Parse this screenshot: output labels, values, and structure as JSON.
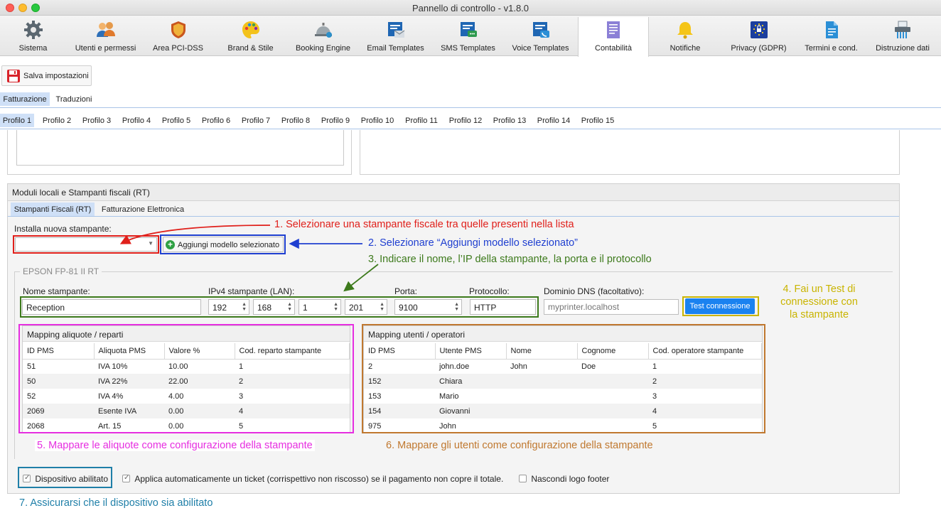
{
  "window": {
    "title": "Pannello di controllo - v1.8.0"
  },
  "toolbar": {
    "items": [
      {
        "label": "Sistema",
        "icon": "gear-icon"
      },
      {
        "label": "Utenti e permessi",
        "icon": "users-icon"
      },
      {
        "label": "Area PCI-DSS",
        "icon": "shield-icon"
      },
      {
        "label": "Brand & Stile",
        "icon": "palette-icon"
      },
      {
        "label": "Booking Engine",
        "icon": "service-bell-icon"
      },
      {
        "label": "Email Templates",
        "icon": "email-template-icon"
      },
      {
        "label": "SMS Templates",
        "icon": "sms-template-icon"
      },
      {
        "label": "Voice Templates",
        "icon": "voice-template-icon"
      },
      {
        "label": "Contabilità",
        "icon": "ledger-icon"
      },
      {
        "label": "Notifiche",
        "icon": "bell-icon"
      },
      {
        "label": "Privacy (GDPR)",
        "icon": "gdpr-lock-icon"
      },
      {
        "label": "Termini e cond.",
        "icon": "document-icon"
      },
      {
        "label": "Distruzione dati",
        "icon": "shredder-icon"
      }
    ],
    "active_item": "Contabilità"
  },
  "actions": {
    "save_label": "Salva impostazioni"
  },
  "main_tabs": [
    "Fatturazione",
    "Traduzioni"
  ],
  "profile_tabs": [
    "Profilo 1",
    "Profilo 2",
    "Profilo 3",
    "Profilo 4",
    "Profilo 5",
    "Profilo 6",
    "Profilo 7",
    "Profilo 8",
    "Profilo 9",
    "Profilo 10",
    "Profilo 11",
    "Profilo 12",
    "Profilo 13",
    "Profilo 14",
    "Profilo 15"
  ],
  "rt_section": {
    "title": "Moduli locali e Stampanti fiscali (RT)",
    "tabs": [
      "Stampanti Fiscali (RT)",
      "Fatturazione Elettronica"
    ],
    "install_label": "Installa nuova stampante:",
    "install_select_value": "",
    "add_model_label": "Aggiungi modello selezionato",
    "printer_group_title": "EPSON FP-81 II RT",
    "fields": {
      "name_label": "Nome stampante:",
      "name_value": "Reception",
      "ip_label": "IPv4 stampante (LAN):",
      "ip_octets": [
        "192",
        "168",
        "1",
        "201"
      ],
      "port_label": "Porta:",
      "port_value": "9100",
      "protocol_label": "Protocollo:",
      "protocol_value": "HTTP",
      "dns_label": "Dominio DNS (facoltativo):",
      "dns_placeholder": "myprinter.localhost",
      "test_button_label": "Test connessione"
    },
    "vat_mapping": {
      "title": "Mapping aliquote / reparti",
      "columns": [
        "ID PMS",
        "Aliquota PMS",
        "Valore %",
        "Cod. reparto stampante"
      ],
      "rows": [
        [
          "51",
          "IVA 10%",
          "10.00",
          "1"
        ],
        [
          "50",
          "IVA 22%",
          "22.00",
          "2"
        ],
        [
          "52",
          "IVA 4%",
          "4.00",
          "3"
        ],
        [
          "2069",
          "Esente IVA",
          "0.00",
          "4"
        ],
        [
          "2068",
          "Art. 15",
          "0.00",
          "5"
        ]
      ]
    },
    "user_mapping": {
      "title": "Mapping utenti / operatori",
      "columns": [
        "ID PMS",
        "Utente PMS",
        "Nome",
        "Cognome",
        "Cod. operatore stampante"
      ],
      "rows": [
        [
          "2",
          "john.doe",
          "John",
          "Doe",
          "1"
        ],
        [
          "152",
          "Chiara",
          "",
          "",
          "2"
        ],
        [
          "153",
          "Mario",
          "",
          "",
          "3"
        ],
        [
          "154",
          "Giovanni",
          "",
          "",
          "4"
        ],
        [
          "975",
          "John",
          "",
          "",
          "5"
        ]
      ]
    },
    "checkboxes": {
      "enabled_label": "Dispositivo abilitato",
      "enabled_checked": true,
      "auto_ticket_label": "Applica automaticamente un ticket (corrispettivo non riscosso) se il pagamento non copre il totale.",
      "auto_ticket_checked": true,
      "hide_logo_label": "Nascondi logo footer",
      "hide_logo_checked": false
    }
  },
  "annotations": {
    "step1": "1. Selezionare una stampante fiscale tra quelle presenti nella lista",
    "step2": "2. Selezionare “Aggiungi modello selezionato”",
    "step3": "3. Indicare il nome, l’IP della stampante, la porta e il protocollo",
    "step4_line1": "4. Fai un Test di",
    "step4_line2": "connessione con",
    "step4_line3": "la stampante",
    "step5": "5. Mappare le aliquote come configurazione della stampante",
    "step6": "6. Mappare gli utenti come configurazione della stampante",
    "step7": "7. Assicurarsi che il dispositivo sia abilitato"
  },
  "colors": {
    "step1": "#e0201b",
    "step2": "#1f3fd0",
    "step3": "#3d7a1c",
    "step4": "#c9b400",
    "step5": "#e62ee0",
    "step6": "#c0782f",
    "step7": "#1f7fa8",
    "primary_button": "#1a82f0",
    "active_tab": "#cfe0f7"
  }
}
